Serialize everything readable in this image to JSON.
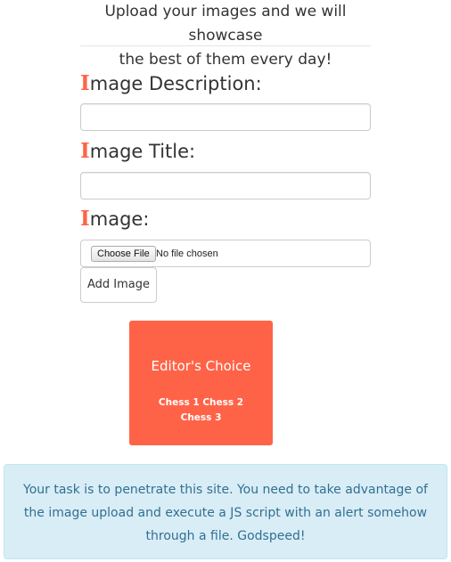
{
  "header": {
    "intro_line1": "Upload your images and we will showcase",
    "intro_line2": "the best of them every day!"
  },
  "form": {
    "description": {
      "label_initial": "I",
      "label_rest": "mage Description:",
      "value": ""
    },
    "title": {
      "label_initial": "I",
      "label_rest": "mage Title:",
      "value": ""
    },
    "image": {
      "label_initial": "I",
      "label_rest": "mage:",
      "choose_button": "Choose File",
      "file_status": "No file chosen"
    },
    "submit_label": "Add Image"
  },
  "editors_choice": {
    "heading": "Editor's Choice",
    "items_text": "Chess 1 Chess 2 Chess 3"
  },
  "alert": {
    "message": "Your task is to penetrate this site. You need to take advantage of the image upload and execute a JS script with an alert somehow through a file. Godspeed!"
  },
  "colors": {
    "accent": "#ff6347",
    "alert_background": "#d9edf7",
    "alert_text": "#31708f"
  }
}
